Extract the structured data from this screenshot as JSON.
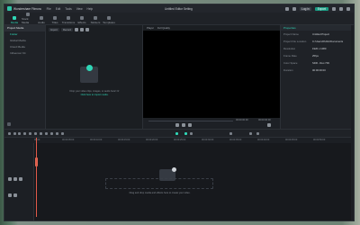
{
  "titlebar": {
    "app_name": "Wondershare Filmora",
    "menus": [
      "File",
      "Edit",
      "Tools",
      "View",
      "Help"
    ],
    "project_title": "Untitled Editor Setting",
    "login_label": "Log in",
    "export_label": "Export"
  },
  "toolbar": {
    "tools": [
      {
        "label": "Media",
        "active": true
      },
      {
        "label": "Stock Media",
        "active": false
      },
      {
        "label": "Audio",
        "active": false
      },
      {
        "label": "Titles",
        "active": false
      },
      {
        "label": "Transitions",
        "active": false
      },
      {
        "label": "Effects",
        "active": false
      },
      {
        "label": "Stickers",
        "active": false
      },
      {
        "label": "Templates",
        "active": false
      }
    ]
  },
  "sidebar": {
    "header": "Project Media",
    "items": [
      {
        "label": "Folder",
        "selected": true
      },
      {
        "label": "Global Media",
        "selected": false
      },
      {
        "label": "Cloud Media",
        "selected": false
      },
      {
        "label": "Influencer Kit",
        "selected": false
      }
    ]
  },
  "media": {
    "import_label": "Import",
    "record_label": "Record",
    "drop_text": "Drop your video clips, images, or audio here! Or",
    "drop_link": "Click here to import media."
  },
  "player": {
    "tab_player": "Player",
    "tab_quality": "Full Quality",
    "time_current": "00:00:00:00",
    "time_total": "00:00:00:00"
  },
  "properties": {
    "header": "Properties",
    "rows": [
      {
        "key": "Project Name",
        "value": "Untitled Project"
      },
      {
        "key": "Project File Location",
        "value": "C:/Users/Public/Documents"
      },
      {
        "key": "Resolution",
        "value": "1920 x 1080"
      },
      {
        "key": "Frame Rate",
        "value": "25fps"
      },
      {
        "key": "Color Space",
        "value": "SDR - Rec.709"
      },
      {
        "key": "Duration",
        "value": "00:00:00:00"
      }
    ]
  },
  "timeline": {
    "ruler": [
      "00:00",
      "00:00:05:00",
      "00:00:10:00",
      "00:00:15:00",
      "00:00:20:00",
      "00:00:25:00",
      "00:00:30:00",
      "00:00:35:00",
      "00:00:40:00",
      "00:00:45:00",
      "00:00:50:00"
    ],
    "drop_text": "Drag and drop media and effects here to create your video."
  }
}
